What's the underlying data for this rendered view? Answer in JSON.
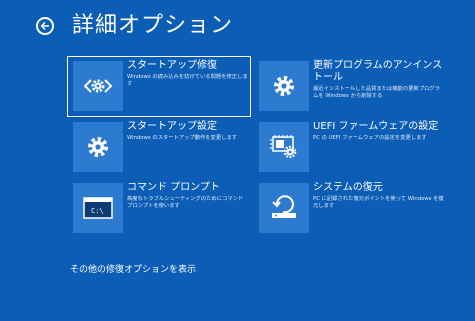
{
  "header": {
    "title": "詳細オプション",
    "back_icon": "back-arrow-icon"
  },
  "options": [
    {
      "title": "スタートアップ修復",
      "description": "Windows の読み込みを妨げている問題を修正します",
      "icon": "code-brackets-gear-icon",
      "selected": true
    },
    {
      "title": "更新プログラムのアンインストール",
      "description": "最近インストールした品質または機能の更新プログラムを Windows から削除する",
      "icon": "gear-icon",
      "selected": false
    },
    {
      "title": "スタートアップ設定",
      "description": "Windows のスタートアップ動作を変更します",
      "icon": "gear-icon",
      "selected": false
    },
    {
      "title": "UEFI ファームウェアの設定",
      "description": "PC の UEFI ファームウェアの設定を変更します",
      "icon": "firmware-chip-icon",
      "selected": false
    },
    {
      "title": "コマンド プロンプト",
      "description": "高度なトラブルシューティングのためにコマンド プロンプトを使います",
      "icon": "command-prompt-icon",
      "icon_text": "C:\\",
      "selected": false
    },
    {
      "title": "システムの復元",
      "description": "PC に記録された復元ポイントを使って Windows を復元します",
      "icon": "system-restore-icon",
      "selected": false
    }
  ],
  "more_link": "その他の修復オプションを表示",
  "colors": {
    "background": "#0c5db5",
    "tile": "#2d7bd1",
    "text": "#ffffff"
  }
}
